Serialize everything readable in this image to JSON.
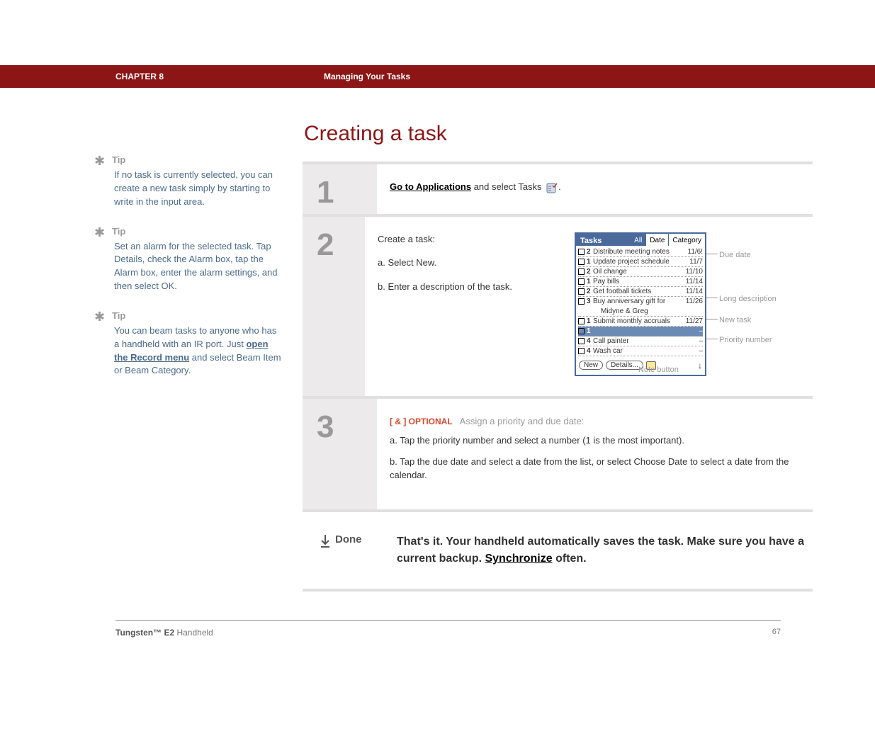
{
  "header": {
    "chapter": "CHAPTER 8",
    "title": "Managing Your Tasks"
  },
  "tips": [
    {
      "label": "Tip",
      "body_html": "If no task is currently selected, you can create a new task simply by starting to write in the input area."
    },
    {
      "label": "Tip",
      "body_html": "Set an alarm for the selected task. Tap Details, check the Alarm box, tap the Alarm box, enter the alarm settings, and then select OK."
    },
    {
      "label": "Tip",
      "body_html": "You can beam tasks to anyone who has a handheld with an IR port. Just <a href='#'>open the Record menu</a> and select Beam Item or Beam Category."
    }
  ],
  "main": {
    "section_title": "Creating a task",
    "step1": {
      "num": "1",
      "link_text": "Go to Applications",
      "after_link": " and select Tasks "
    },
    "step2": {
      "num": "2",
      "title": "Create a task:",
      "sub_a": "a.  Select New.",
      "sub_b": "b.  Enter a description of the task."
    },
    "step3": {
      "num": "3",
      "tag": "[ & ]  OPTIONAL",
      "tag_text": "Assign a priority and due date:",
      "a": "a.  Tap the priority number and select a number (1 is the most important).",
      "b": "b.  Tap the due date and select a date from the list, or select Choose Date to select a date from the calendar."
    },
    "done": {
      "label": "Done",
      "text_before": "That's it. Your handheld automatically saves the task. Make sure you have a current backup. ",
      "link": "Synchronize",
      "text_after": " often."
    }
  },
  "chart_data": {
    "type": "table",
    "title": "Tasks",
    "tabs": [
      "All",
      "Date",
      "Category"
    ],
    "active_tab": "All",
    "rows": [
      {
        "priority": "2",
        "desc": "Distribute meeting notes",
        "due": "11/6!"
      },
      {
        "priority": "1",
        "desc": "Update project schedule",
        "due": "11/7"
      },
      {
        "priority": "2",
        "desc": "Oil change",
        "due": "11/10"
      },
      {
        "priority": "1",
        "desc": "Pay bills",
        "due": "11/14"
      },
      {
        "priority": "2",
        "desc": "Get football tickets",
        "due": "11/14"
      },
      {
        "priority": "3",
        "desc": "Buy anniversary gift for Midyne & Greg",
        "due": "11/26"
      },
      {
        "priority": "1",
        "desc": "Submit monthly accruals",
        "due": "11/27"
      },
      {
        "priority": "1",
        "desc": "",
        "due": "–",
        "selected": true
      },
      {
        "priority": "4",
        "desc": "Call painter",
        "due": "–"
      },
      {
        "priority": "4",
        "desc": "Wash car",
        "due": "–"
      }
    ],
    "buttons": [
      "New",
      "Details..."
    ],
    "callouts": [
      "Due date",
      "Long description",
      "New task",
      "Priority number",
      "Note button"
    ]
  },
  "footer": {
    "product_bold": "Tungsten™ E2",
    "product_rest": " Handheld",
    "page": "67"
  }
}
